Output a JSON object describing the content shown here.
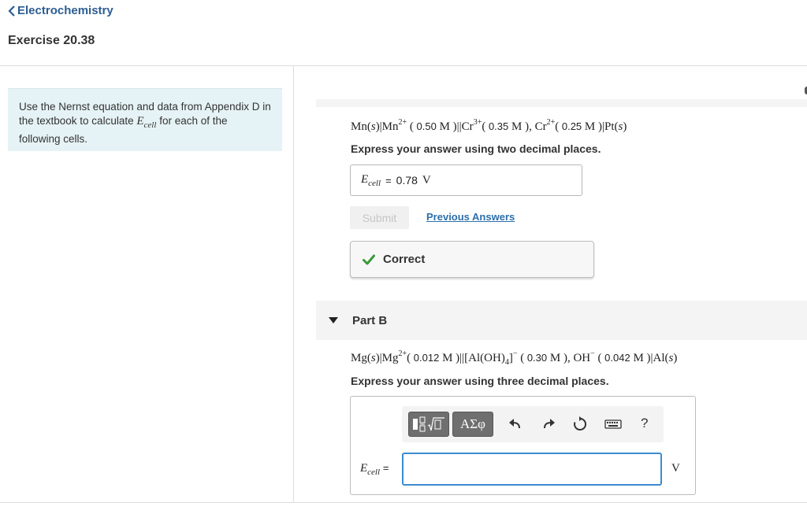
{
  "header": {
    "back_link": "Electrochemistry",
    "exercise_title": "Exercise 20.38"
  },
  "instructions": {
    "text_before": "Use the Nernst equation and data from Appendix D in the textbook to calculate",
    "var_main": "E",
    "var_sub": "cell",
    "text_after": "for each of the following cells."
  },
  "part_a": {
    "eq": {
      "t1": "Mn(",
      "s": "s",
      "t2": ")|Mn",
      "sup1": "2+",
      "p1": " (",
      "c1": " 0.50",
      "m1": " M )||Cr",
      "sup2": "3+",
      "p2": "(",
      "c2": " 0.35",
      "m2": " M ),  Cr",
      "sup3": "2+",
      "p3": "(",
      "c3": " 0.25",
      "m3": " M )|Pt(",
      "s2": "s",
      "end": ")"
    },
    "instruction": "Express your answer using two decimal places.",
    "answer_label_main": "E",
    "answer_label_sub": "cell",
    "equals": "=",
    "answer_value": "0.78",
    "unit": "V",
    "submit_label": "Submit",
    "previous_answers": "Previous Answers",
    "feedback": "Correct",
    "feedback_color": "#3a9a3a"
  },
  "part_b": {
    "title": "Part B",
    "eq": {
      "t1": "Mg(",
      "s": "s",
      "t2": ")|Mg",
      "sup1": "2+",
      "p1": "(",
      "c1": " 0.012",
      "m1": " M )||[Al(OH)",
      "sub4": "4",
      "m1b": "]",
      "sup2": "−",
      "p2": " (",
      "c2": " 0.30",
      "m2": " M ),  OH",
      "sup3": "−",
      "p3": "  (",
      "c3": " 0.042",
      "m3": " M )|Al(",
      "s2": "s",
      "end": ")"
    },
    "instruction": "Express your answer using three decimal places.",
    "answer_label_main": "E",
    "answer_label_sub": "cell",
    "equals": "=",
    "answer_value": "",
    "unit": "V",
    "toolbar": {
      "greek_label": "ΑΣφ",
      "help_label": "?"
    }
  },
  "colors": {
    "link": "#2c5d92",
    "instructions_bg": "#e6f3f6",
    "input_focus": "#3c8bd0",
    "check": "#3a9a3a"
  }
}
